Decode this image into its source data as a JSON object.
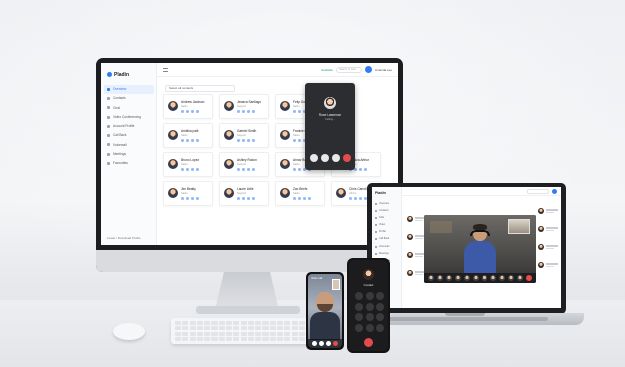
{
  "imac": {
    "brand": "Pladin",
    "nav": [
      "Overview",
      "Contacts",
      "Chat",
      "Video Conferencing",
      "Account Profile",
      "Call Back",
      "Voicemail",
      "Meetings",
      "Favourites"
    ],
    "footer": "Linear / Download Profile",
    "top_status": "Available",
    "search_placeholder": "Search or Dial",
    "user": "Amanda Lee",
    "filter": "Select all contacts",
    "contacts": [
      {
        "name": "Andrew Jackson",
        "sub": "Sales"
      },
      {
        "name": "Jessica Santiago",
        "sub": "Support"
      },
      {
        "name": "Felip Gonzalez",
        "sub": "Sales"
      },
      {
        "name": "Rose Murray",
        "sub": "Admin"
      },
      {
        "name": "Ambika patil",
        "sub": "Sales"
      },
      {
        "name": "Gabriel Smith",
        "sub": "Support"
      },
      {
        "name": "Frankie Cheng",
        "sub": "Sales"
      },
      {
        "name": "Zora Parade",
        "sub": "Admin"
      },
      {
        "name": "Bruno Lopez",
        "sub": "Sales"
      },
      {
        "name": "Ashley Rodon",
        "sub": "Support"
      },
      {
        "name": "Arnav Bose",
        "sub": "Sales"
      },
      {
        "name": "Jessica Arthur",
        "sub": "Admin"
      },
      {
        "name": "Jim Beatty",
        "sub": "Sales"
      },
      {
        "name": "Laurie Little",
        "sub": "Support"
      },
      {
        "name": "Zac Briefs",
        "sub": "Sales"
      },
      {
        "name": "Chris Carroll",
        "sub": "Admin"
      }
    ],
    "call_popup": {
      "name": "Rose Lawrence",
      "status": "Calling..."
    },
    "pager": "Page 1 of 5"
  },
  "laptop": {
    "brand": "Pladin",
    "nav": [
      "Overview",
      "Contacts",
      "Chat",
      "Video",
      "Profile",
      "Call Back",
      "Voicemail",
      "Meetings",
      "Favourites",
      "Settings",
      "Help"
    ]
  },
  "phone1": {
    "caller": "Video call"
  },
  "phone2": {
    "caller": "Contact"
  }
}
